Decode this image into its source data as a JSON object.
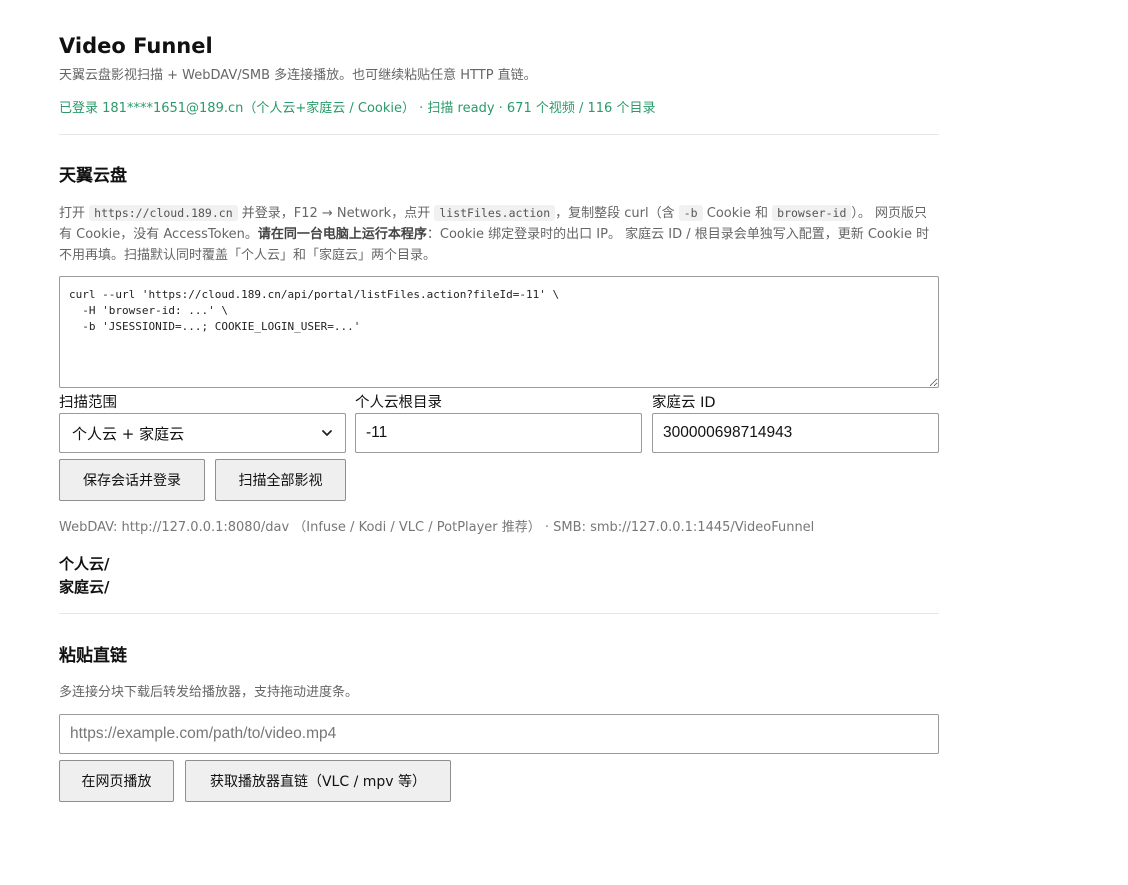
{
  "header": {
    "title": "Video Funnel",
    "subtitle": "天翼云盘影视扫描 + WebDAV/SMB 多连接播放。也可继续粘贴任意 HTTP 直链。",
    "status": "已登录 181****1651@189.cn（个人云+家庭云 / Cookie） · 扫描 ready · 671 个视频 / 116 个目录"
  },
  "cloud": {
    "heading": "天翼云盘",
    "desc": {
      "p1": "打开 ",
      "code1": "https://cloud.189.cn",
      "p2": " 并登录，F12 → Network，点开 ",
      "code2": "listFiles.action",
      "p3": "，复制整段 curl（含 ",
      "code3": "-b",
      "p4": " Cookie 和 ",
      "code4": "browser-id",
      "p5": "）。 网页版只有 Cookie，没有 AccessToken。",
      "bold": "请在同一台电脑上运行本程序",
      "p6": "：Cookie 绑定登录时的出口 IP。 家庭云 ID / 根目录会单独写入配置，更新 Cookie 时不用再填。扫描默认同时覆盖「个人云」和「家庭云」两个目录。"
    },
    "curl_value": "curl --url 'https://cloud.189.cn/api/portal/listFiles.action?fileId=-11' \\\n  -H 'browser-id: ...' \\\n  -b 'JSESSIONID=...; COOKIE_LOGIN_USER=...'",
    "scope_label": "扫描范围",
    "scope_value": "个人云 + 家庭云",
    "root_label": "个人云根目录",
    "root_value": "-11",
    "family_label": "家庭云 ID",
    "family_value": "300000698714943",
    "save_button": "保存会话并登录",
    "scan_button": "扫描全部影视",
    "endpoints": "WebDAV: http://127.0.0.1:8080/dav （Infuse / Kodi / VLC / PotPlayer 推荐） · SMB: smb://127.0.0.1:1445/VideoFunnel",
    "folders": [
      "个人云/",
      "家庭云/"
    ]
  },
  "direct": {
    "heading": "粘贴直链",
    "desc": "多连接分块下载后转发给播放器，支持拖动进度条。",
    "url_placeholder": "https://example.com/path/to/video.mp4",
    "play_button": "在网页播放",
    "link_button": "获取播放器直链（VLC / mpv 等）"
  }
}
